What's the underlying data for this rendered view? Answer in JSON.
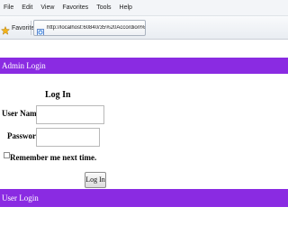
{
  "browser": {
    "menu": [
      "File",
      "Edit",
      "View",
      "Favorites",
      "Tools",
      "Help"
    ],
    "favorites_label": "Favorites",
    "tab_title": "http://localhost:60840/35%20Accordion%20Into/..."
  },
  "page": {
    "admin_section_title": "Admin Login",
    "login_title": "Log In",
    "username_label": "User Name:",
    "password_label": "Password:",
    "remember_label": "Remember me next time.",
    "login_button": "Log In",
    "user_section_title": "User Login",
    "username_value": "",
    "password_value": ""
  },
  "colors": {
    "section_header_bg": "#8a2be2",
    "section_header_text": "#ffffff"
  },
  "icons": {
    "favorites": "star-icon",
    "page": "ie-page-icon"
  }
}
